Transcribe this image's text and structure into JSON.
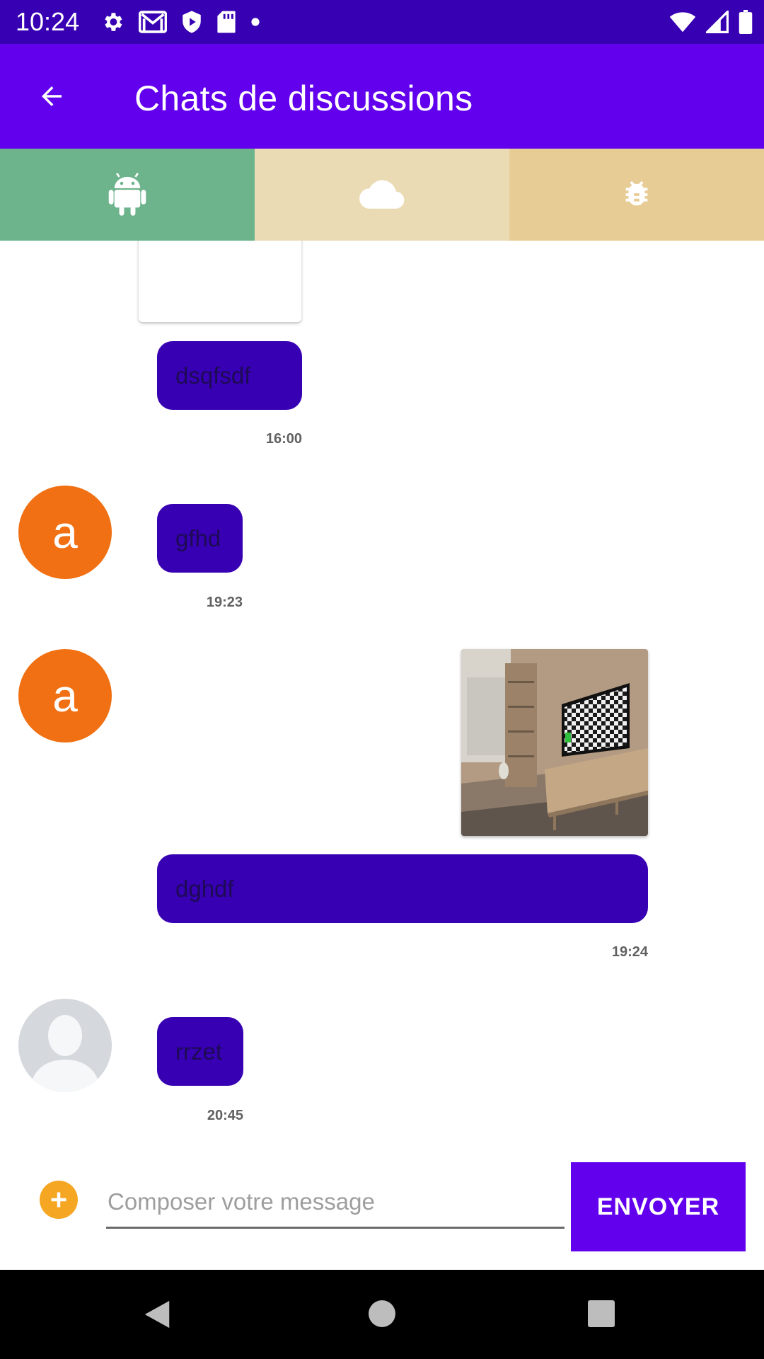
{
  "status_bar": {
    "time": "10:24",
    "icons_left": [
      "gear-icon",
      "gmail-icon",
      "shield-play-icon",
      "sd-card-icon",
      "dot-icon"
    ],
    "icons_right": [
      "wifi-icon",
      "signal-icon",
      "battery-icon"
    ]
  },
  "app_bar": {
    "title": "Chats de discussions",
    "color": "#6200ee",
    "back_icon": "arrow-back-icon"
  },
  "tabs": [
    {
      "icon": "android-icon",
      "color": "#6db38b"
    },
    {
      "icon": "cloud-icon",
      "color": "#eadbb4"
    },
    {
      "icon": "bug-icon",
      "color": "#e8cc96"
    }
  ],
  "messages": [
    {
      "text": "dsqfsdf",
      "time": "16:00"
    },
    {
      "avatar_letter": "a",
      "text": "gfhd",
      "time": "19:23"
    },
    {
      "avatar_letter": "a",
      "text": "dghdf",
      "time": "19:24",
      "image": "tv-room-photo"
    },
    {
      "avatar": "default-user-avatar",
      "text": "rrzet",
      "time": "20:45"
    }
  ],
  "composer": {
    "placeholder": "Composer votre message",
    "value": "",
    "send_label": "ENVOYER",
    "attach_icon": "add-circle-icon"
  },
  "colors": {
    "status_bar": "#3700b3",
    "bubble": "#3700b3",
    "avatar": "#f07013",
    "send_button": "#6200ee",
    "attach": "#f5a623"
  }
}
